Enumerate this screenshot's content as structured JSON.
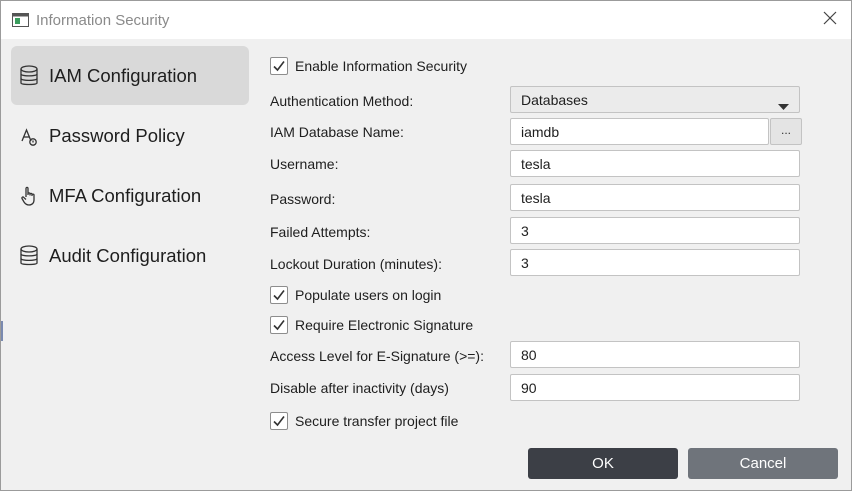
{
  "window": {
    "title": "Information Security",
    "app_icon": "app-window-icon",
    "close_icon": "close-icon"
  },
  "sidebar": {
    "items": [
      {
        "label": "IAM Configuration",
        "icon": "database-icon",
        "active": true
      },
      {
        "label": "Password Policy",
        "icon": "password-policy-icon",
        "active": false
      },
      {
        "label": "MFA Configuration",
        "icon": "touch-hand-icon",
        "active": false
      },
      {
        "label": "Audit Configuration",
        "icon": "database-icon",
        "active": false
      }
    ]
  },
  "form": {
    "enable_security": {
      "label": "Enable Information Security",
      "checked": true
    },
    "auth_method": {
      "label": "Authentication Method:",
      "value": "Databases"
    },
    "iam_db_name": {
      "label": "IAM Database Name:",
      "value": "iamdb",
      "browse_label": "..."
    },
    "username": {
      "label": "Username:",
      "value": "tesla"
    },
    "password": {
      "label": "Password:",
      "value": "tesla"
    },
    "failed_attempts": {
      "label": "Failed Attempts:",
      "value": "3"
    },
    "lockout_duration": {
      "label": "Lockout Duration (minutes):",
      "value": "3"
    },
    "populate_users": {
      "label": "Populate users on login",
      "checked": true
    },
    "require_esig": {
      "label": "Require Electronic Signature",
      "checked": true
    },
    "esig_access_level": {
      "label": "Access Level for E-Signature (>=):",
      "value": "80"
    },
    "disable_inactivity": {
      "label": "Disable after inactivity (days)",
      "value": "90"
    },
    "secure_transfer": {
      "label": "Secure transfer project file",
      "checked": true
    }
  },
  "buttons": {
    "ok": "OK",
    "cancel": "Cancel"
  },
  "colors": {
    "ok_bg": "#3c3f46",
    "cancel_bg": "#6f747b",
    "panel_bg": "#f0f0f0",
    "active_nav_bg": "#d9d9d9"
  }
}
